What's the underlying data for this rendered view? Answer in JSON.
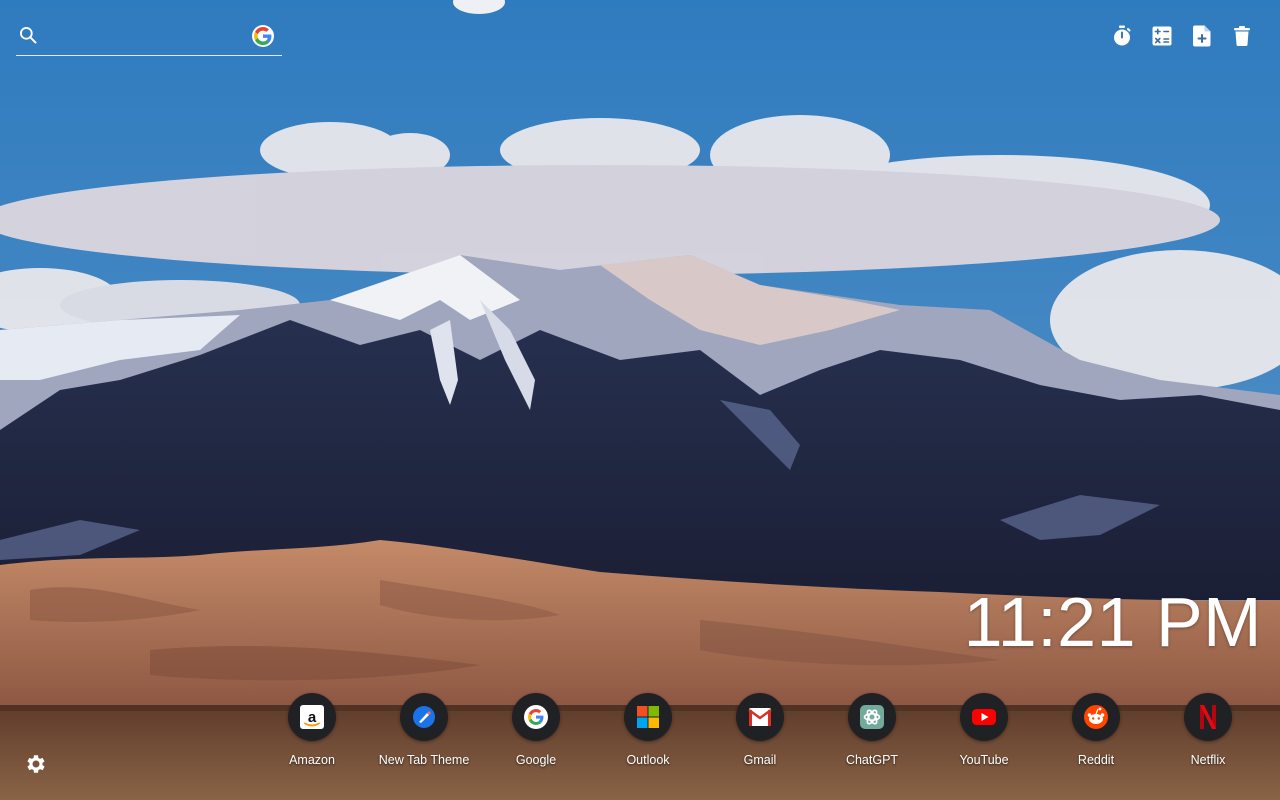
{
  "background": {
    "description_colors": {
      "sky": "#2e79bd",
      "dune": "#b0755a",
      "ground": "#5a3a2c"
    }
  },
  "search": {
    "placeholder": "",
    "value": "",
    "icon": "search-icon",
    "engine_icon": "google-g-icon"
  },
  "tools": [
    {
      "name": "timer-icon"
    },
    {
      "name": "calculator-icon"
    },
    {
      "name": "add-note-icon"
    },
    {
      "name": "trash-icon"
    }
  ],
  "clock": {
    "time": "11:21 PM"
  },
  "shortcuts": [
    {
      "label": "Amazon",
      "icon": "amazon-icon"
    },
    {
      "label": "New Tab Theme",
      "icon": "new-tab-theme-icon"
    },
    {
      "label": "Google",
      "icon": "google-icon"
    },
    {
      "label": "Outlook",
      "icon": "outlook-icon"
    },
    {
      "label": "Gmail",
      "icon": "gmail-icon"
    },
    {
      "label": "ChatGPT",
      "icon": "chatgpt-icon"
    },
    {
      "label": "YouTube",
      "icon": "youtube-icon"
    },
    {
      "label": "Reddit",
      "icon": "reddit-icon"
    },
    {
      "label": "Netflix",
      "icon": "netflix-icon"
    }
  ],
  "settings": {
    "icon": "gear-icon"
  }
}
